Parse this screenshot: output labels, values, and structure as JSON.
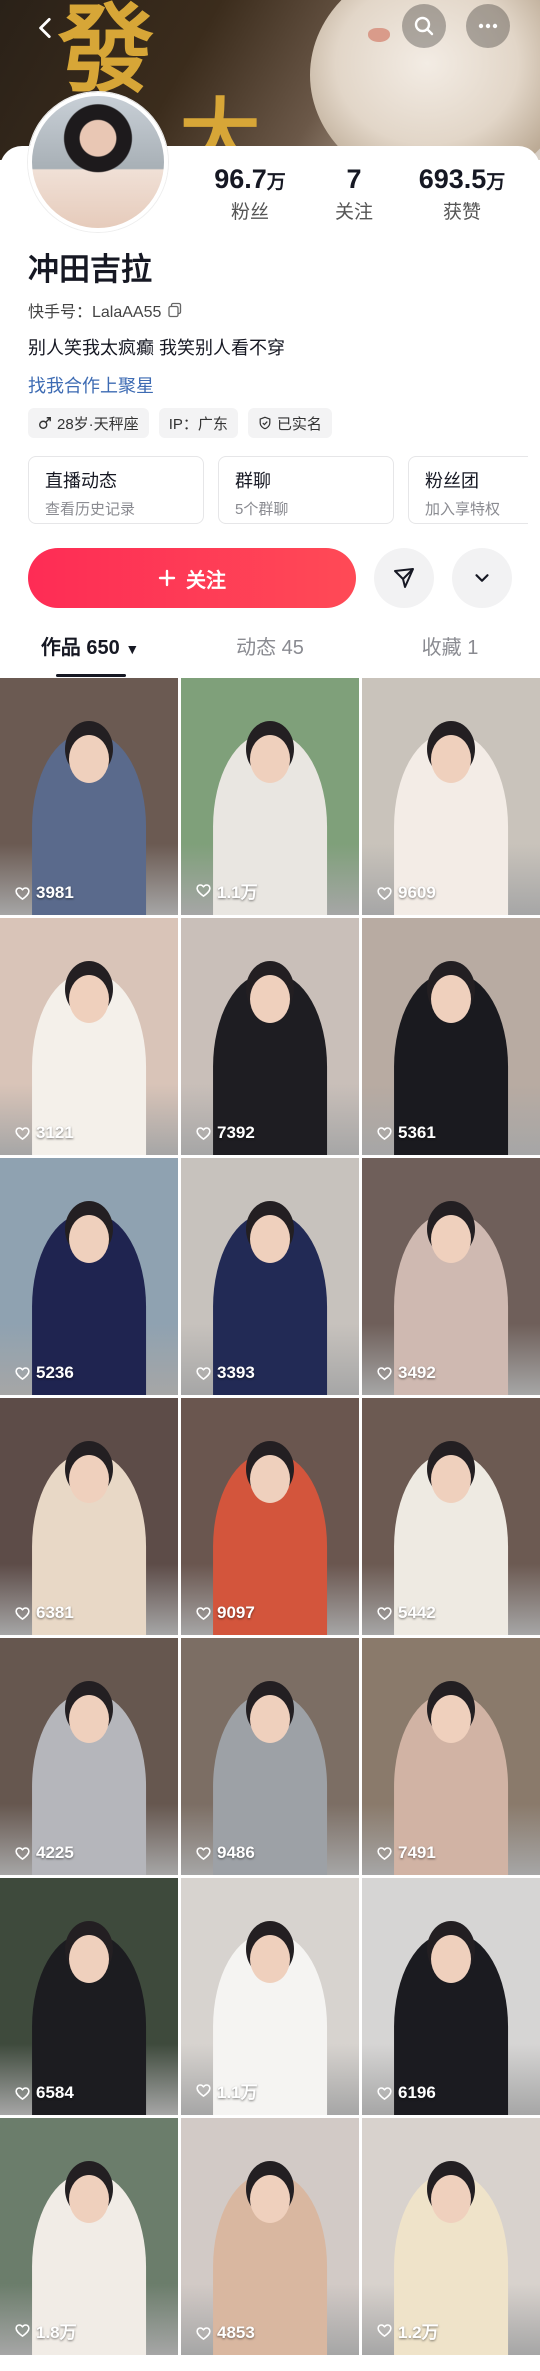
{
  "header": {
    "icons": [
      "back-icon",
      "search-icon",
      "more-icon"
    ],
    "cover_chars": [
      "發",
      "大"
    ]
  },
  "profile": {
    "name": "冲田吉拉",
    "kuaishou_id": "快手号：LalaAA55",
    "bio": "别人笑我太疯癫  我笑别人看不穿",
    "cooperation_link": "找我合作上聚星",
    "stats": [
      {
        "value": "96.7",
        "unit": "万",
        "label": "粉丝"
      },
      {
        "value": "7",
        "unit": "",
        "label": "关注"
      },
      {
        "value": "693.5",
        "unit": "万",
        "label": "获赞"
      }
    ],
    "tags": [
      {
        "icon": "gender-male-icon",
        "text": "28岁·天秤座"
      },
      {
        "icon": "",
        "text": "IP：广东"
      },
      {
        "icon": "shield-check-icon",
        "text": "已实名"
      }
    ]
  },
  "cards": [
    {
      "title": "直播动态",
      "subtitle": "查看历史记录"
    },
    {
      "title": "群聊",
      "subtitle": "5个群聊"
    },
    {
      "title": "粉丝团",
      "subtitle": "加入享特权"
    }
  ],
  "actions": {
    "follow_label": "关注",
    "share_icon": "send-icon",
    "more_icon": "chevron-down-icon"
  },
  "tabs": [
    {
      "label": "作品 650"
    },
    {
      "label": "动态 45"
    },
    {
      "label": "收藏 1"
    }
  ],
  "videos": [
    {
      "likes": "3981",
      "bg": "#6b5a52",
      "outfit": "#5a6a8c"
    },
    {
      "likes": "1.1万",
      "bg": "#7fa07a",
      "outfit": "#e9e6e1"
    },
    {
      "likes": "9609",
      "bg": "#c9c3bb",
      "outfit": "#f3ece6"
    },
    {
      "likes": "3121",
      "bg": "#d9c4b8",
      "outfit": "#f4f0ea"
    },
    {
      "likes": "7392",
      "bg": "#c9bfb9",
      "outfit": "#1e1d22"
    },
    {
      "likes": "5361",
      "bg": "#b8aba2",
      "outfit": "#1a1a1f"
    },
    {
      "likes": "5236",
      "bg": "#8fa2b1",
      "outfit": "#1f2450"
    },
    {
      "likes": "3393",
      "bg": "#c7c2bd",
      "outfit": "#222a55"
    },
    {
      "likes": "3492",
      "bg": "#6f5f5a",
      "outfit": "#cfb9b1"
    },
    {
      "likes": "6381",
      "bg": "#5d4c48",
      "outfit": "#e8d8c6"
    },
    {
      "likes": "9097",
      "bg": "#6a564f",
      "outfit": "#d3553c"
    },
    {
      "likes": "5442",
      "bg": "#6c5a52",
      "outfit": "#eeeae2"
    },
    {
      "likes": "4225",
      "bg": "#66574f",
      "outfit": "#b5b6bb"
    },
    {
      "likes": "9486",
      "bg": "#7c6e64",
      "outfit": "#9da1a6"
    },
    {
      "likes": "7491",
      "bg": "#8a7a6b",
      "outfit": "#d1b3a4"
    },
    {
      "likes": "6584",
      "bg": "#3e4a3c",
      "outfit": "#1c1c20"
    },
    {
      "likes": "1.1万",
      "bg": "#d7d3cf",
      "outfit": "#f5f4f2"
    },
    {
      "likes": "6196",
      "bg": "#d6d5d4",
      "outfit": "#1b1b20"
    },
    {
      "likes": "1.8万",
      "bg": "#6b7d6b",
      "outfit": "#f1ece6"
    },
    {
      "likes": "4853",
      "bg": "#d2cac6",
      "outfit": "#d9b7a0"
    },
    {
      "likes": "1.2万",
      "bg": "#d8d2cd",
      "outfit": "#efe3c9"
    }
  ]
}
